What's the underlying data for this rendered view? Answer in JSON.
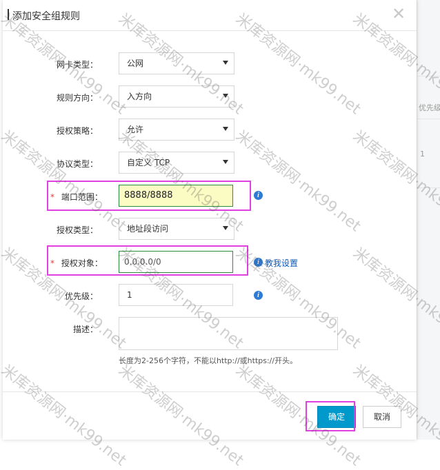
{
  "dialog": {
    "title": "添加安全组规则",
    "close_glyph": "✕"
  },
  "background": {
    "col_header": "优先级",
    "row_value": "1"
  },
  "form": {
    "nic_type": {
      "label": "网卡类型：",
      "value": "公网"
    },
    "direction": {
      "label": "规则方向：",
      "value": "入方向"
    },
    "policy": {
      "label": "授权策略：",
      "value": "允许"
    },
    "protocol": {
      "label": "协议类型：",
      "value": "自定义 TCP"
    },
    "port_range": {
      "label": "端口范围：",
      "value": "8888/8888",
      "required_mark": "*"
    },
    "auth_type": {
      "label": "授权类型：",
      "value": "地址段访问"
    },
    "auth_object": {
      "label": "授权对象：",
      "value": "0.0.0.0/0",
      "required_mark": "*",
      "link": "教我设置"
    },
    "priority": {
      "label": "优先级：",
      "value": "1"
    },
    "description": {
      "label": "描述：",
      "value": "",
      "help": "长度为2-256个字符，不能以http://或https://开头。"
    }
  },
  "buttons": {
    "confirm": "确定",
    "cancel": "取消"
  },
  "info_glyph": "i",
  "watermark": {
    "text": "米库资源网·mk99.net"
  },
  "colors": {
    "primary": "#0099cc",
    "link": "#0c58b8",
    "info": "#2e7bd6",
    "highlight_bg": "#fbfbc4",
    "annotation": "#e040e0",
    "required": "#e03d3d"
  }
}
